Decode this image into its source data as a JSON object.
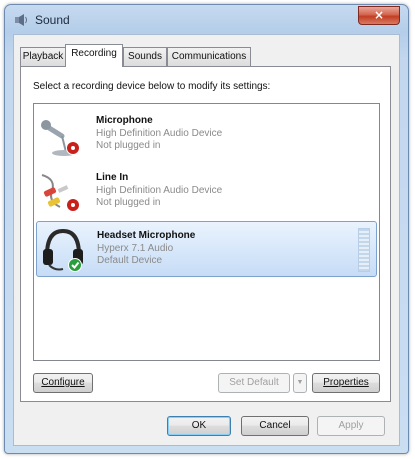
{
  "window": {
    "title": "Sound",
    "close_glyph": "×"
  },
  "tabs": [
    {
      "label": "Playback",
      "active": false
    },
    {
      "label": "Recording",
      "active": true
    },
    {
      "label": "Sounds",
      "active": false
    },
    {
      "label": "Communications",
      "active": false
    }
  ],
  "instruction": "Select a recording device below to modify its settings:",
  "devices": [
    {
      "name": "Microphone",
      "description": "High Definition Audio Device",
      "status": "Not plugged in",
      "icon": "microphone-icon",
      "badge": "unplugged-badge",
      "selected": false
    },
    {
      "name": "Line In",
      "description": "High Definition Audio Device",
      "status": "Not plugged in",
      "icon": "line-in-cable-icon",
      "badge": "unplugged-badge",
      "selected": false
    },
    {
      "name": "Headset Microphone",
      "description": "Hyperx 7.1 Audio",
      "status": "Default Device",
      "icon": "headset-icon",
      "badge": "default-check-badge",
      "selected": true
    }
  ],
  "buttons": {
    "configure": "Configure",
    "set_default": "Set Default",
    "set_default_arrow": "▼",
    "properties": "Properties",
    "ok": "OK",
    "cancel": "Cancel",
    "apply": "Apply"
  },
  "colors": {
    "selection": "#cce0f7",
    "title_bar": "#c6daf0",
    "close_button": "#c13e24"
  }
}
